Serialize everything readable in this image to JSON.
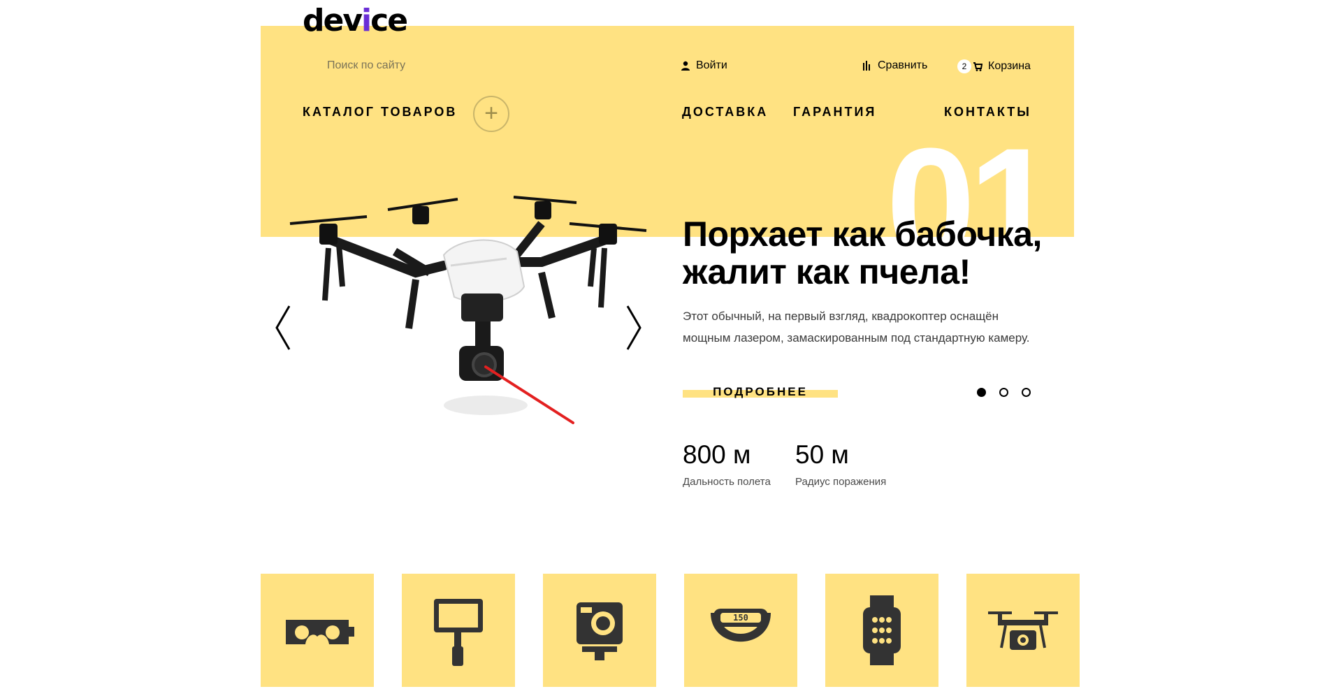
{
  "header": {
    "logo": {
      "before": "dev",
      "accent": "i",
      "after": "ce"
    },
    "search_placeholder": "Поиск по сайту",
    "login": "Войти",
    "compare": "Сравнить",
    "cart": {
      "label": "Корзина",
      "count": "2"
    }
  },
  "nav": {
    "catalog": "КАТАЛОГ ТОВАРОВ",
    "plus": "+",
    "delivery": "ДОСТАВКА",
    "warranty": "ГАРАНТИЯ",
    "contacts": "КОНТАКТЫ"
  },
  "slide": {
    "number": "01",
    "title_line1": "Порхает как бабочка,",
    "title_line2": "жалит как пчела!",
    "desc_line1": "Этот обычный, на первый взгляд, квадрокоптер оснащён",
    "desc_line2": "мощным лазером, замаскированным под стандартную камеру.",
    "more": "ПОДРОБНЕЕ",
    "dots_total": 3,
    "active_dot": 1
  },
  "stats": [
    {
      "value": "800 м",
      "label": "Дальность полета"
    },
    {
      "value": "50 м",
      "label": "Радиус поражения"
    }
  ],
  "categories": [
    {
      "icon": "vr-headset-icon"
    },
    {
      "icon": "selfie-stick-icon"
    },
    {
      "icon": "action-camera-icon"
    },
    {
      "icon": "fitness-band-icon",
      "display": "150"
    },
    {
      "icon": "smartwatch-icon"
    },
    {
      "icon": "quadcopter-icon"
    }
  ],
  "colors": {
    "accent": "#ffe282",
    "icon": "#333333",
    "laser": "#e32020"
  }
}
